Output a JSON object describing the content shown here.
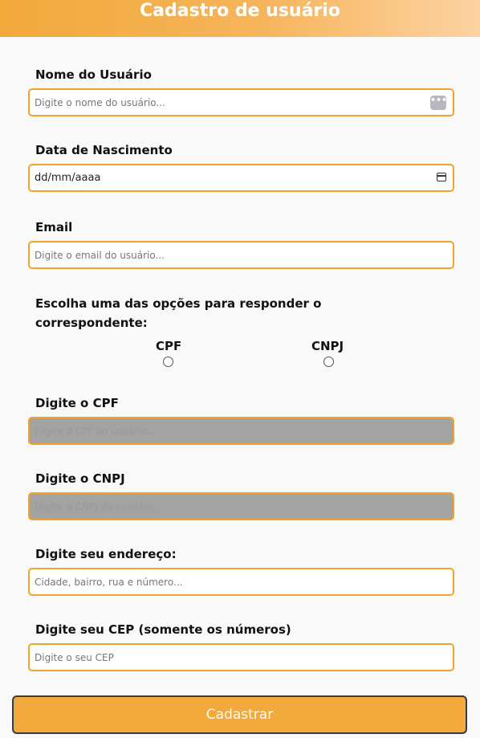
{
  "header": {
    "title": "Cadastro de usuário"
  },
  "form": {
    "name": {
      "label": "Nome do Usuário",
      "placeholder": "Digite o nome do usuário..."
    },
    "birth": {
      "label": "Data de Nascimento",
      "value": "dd/mm/aaaa"
    },
    "email": {
      "label": "Email",
      "placeholder": "Digite o email do usuário..."
    },
    "choice": {
      "question": "Escolha uma das opções para responder o correspondente:",
      "options": [
        "CPF",
        "CNPJ"
      ]
    },
    "cpf": {
      "label": "Digite o CPF",
      "placeholder": "Digite o CPF do usuário..."
    },
    "cnpj": {
      "label": "Digite o CNPJ",
      "placeholder": "Digite o CNPJ do usuário..."
    },
    "address": {
      "label": "Digite seu endereço:",
      "placeholder": "Cidade, bairro, rua e número..."
    },
    "cep": {
      "label": "Digite seu CEP (somente os números)",
      "placeholder": "Digite o seu CEP"
    },
    "submit_label": "Cadastrar"
  },
  "colors": {
    "accent": "#f2a42a",
    "disabled": "#a3a3a3",
    "button": "#f2aa3c"
  },
  "icons": {
    "name_field": "more-dots-icon",
    "birth_field": "calendar-icon"
  }
}
